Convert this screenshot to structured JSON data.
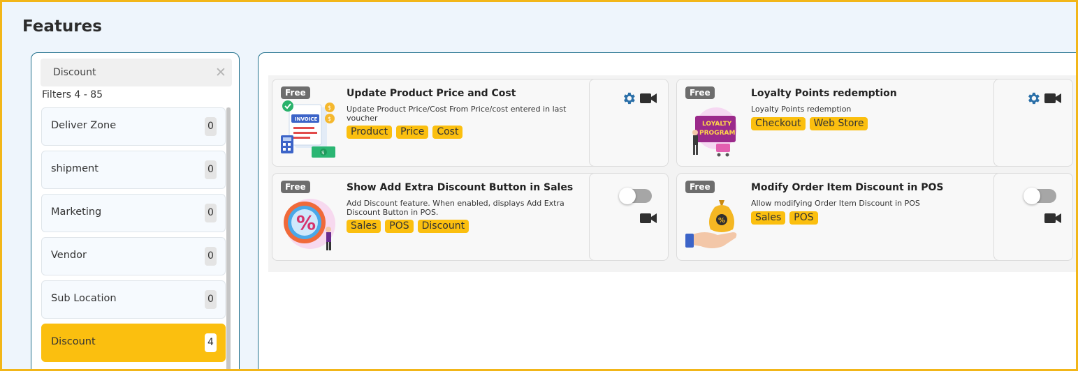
{
  "page": {
    "title": "Features"
  },
  "sidebar": {
    "search": {
      "value": "Discount",
      "placeholder": ""
    },
    "filter_count": "Filters 4 - 85",
    "items": [
      {
        "label": "Deliver Zone",
        "count": "0",
        "active": false
      },
      {
        "label": "shipment",
        "count": "0",
        "active": false
      },
      {
        "label": "Marketing",
        "count": "0",
        "active": false
      },
      {
        "label": "Vendor",
        "count": "0",
        "active": false
      },
      {
        "label": "Sub Location",
        "count": "0",
        "active": false
      },
      {
        "label": "Discount",
        "count": "4",
        "active": true
      }
    ]
  },
  "cards": [
    {
      "badge": "Free",
      "title": "Update Product Price and Cost",
      "description": "Update Product Price/Cost From Price/cost entered in last voucher",
      "tags": [
        "Product",
        "Price",
        "Cost"
      ],
      "control": "settings",
      "illustration": "invoice-illustration"
    },
    {
      "badge": "Free",
      "title": "Loyalty Points redemption",
      "description": "Loyalty Points redemption",
      "tags": [
        "Checkout",
        "Web Store"
      ],
      "control": "settings",
      "illustration": "loyalty-program-illustration",
      "illustration_text": [
        "LOYALTY",
        "PROGRAM"
      ]
    },
    {
      "badge": "Free",
      "title": "Show Add Extra Discount Button in Sales",
      "description": "Add Discount feature. When enabled, displays Add Extra Discount Button in POS.",
      "tags": [
        "Sales",
        "POS",
        "Discount"
      ],
      "control": "toggle",
      "enabled": false,
      "illustration": "percent-discount-illustration"
    },
    {
      "badge": "Free",
      "title": "Modify Order Item Discount in POS",
      "description": "Allow modifying Order Item Discount in POS",
      "tags": [
        "Sales",
        "POS"
      ],
      "control": "toggle",
      "enabled": false,
      "illustration": "money-bag-hand-illustration"
    }
  ],
  "colors": {
    "accent": "#fbbf0f",
    "frame": "#f2b619",
    "panel_border": "#1f6f8b",
    "gear": "#2a6fa8",
    "badge": "#6d6d6d"
  },
  "icons": {
    "clear": "close-icon",
    "settings": "gear-icon",
    "video": "video-camera-icon",
    "toggle": "toggle-switch"
  }
}
